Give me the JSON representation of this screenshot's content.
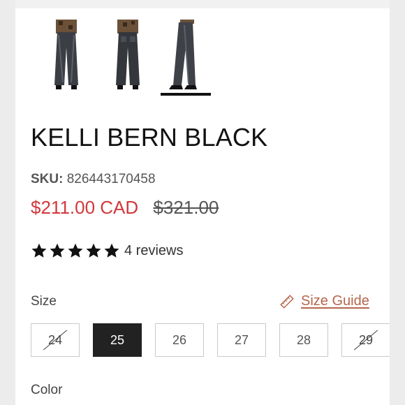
{
  "product": {
    "title": "KELLI BERN BLACK",
    "sku_label": "SKU:",
    "sku_value": "826443170458",
    "price_sale": "$211.00 CAD",
    "price_original": "$321.00",
    "rating": 5,
    "reviews_text": "4 reviews"
  },
  "thumbnails": [
    {
      "name": "jeans-front-view"
    },
    {
      "name": "jeans-back-view"
    },
    {
      "name": "jeans-side-view",
      "selected": true
    }
  ],
  "size": {
    "label": "Size",
    "guide_text": "Size Guide",
    "options": [
      {
        "label": "24",
        "available": false,
        "selected": false
      },
      {
        "label": "25",
        "available": true,
        "selected": true
      },
      {
        "label": "26",
        "available": true,
        "selected": false
      },
      {
        "label": "27",
        "available": true,
        "selected": false
      },
      {
        "label": "28",
        "available": true,
        "selected": false
      },
      {
        "label": "29",
        "available": false,
        "selected": false
      }
    ]
  },
  "color": {
    "label": "Color"
  },
  "icons": {
    "star": "star-icon",
    "ruler": "ruler-icon"
  },
  "colors": {
    "sale": "#d0383c",
    "guide": "#b5654a",
    "selected_bg": "#222222"
  }
}
